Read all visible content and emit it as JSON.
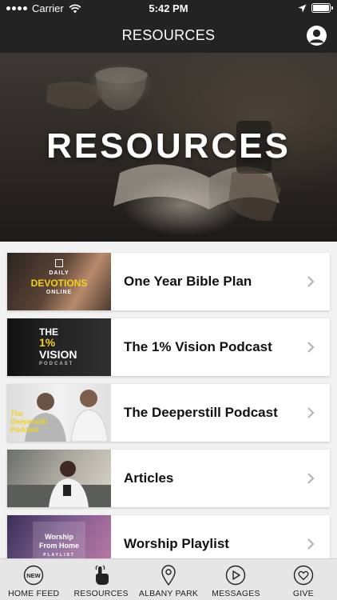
{
  "status_bar": {
    "carrier": "Carrier",
    "time": "5:42 PM"
  },
  "header": {
    "title": "RESOURCES"
  },
  "hero": {
    "title": "RESOURCES"
  },
  "items": [
    {
      "label": "One Year Bible Plan",
      "thumb_lines": [
        "DAILY",
        "DEVOTIONS",
        "ONLINE"
      ]
    },
    {
      "label": "The 1% Vision Podcast",
      "thumb_lines": [
        "THE",
        "1%",
        "VISION",
        "PODCAST"
      ]
    },
    {
      "label": "The Deeperstill Podcast",
      "thumb_lines": [
        "The",
        "Deeperstill",
        "Podcast"
      ]
    },
    {
      "label": "Articles"
    },
    {
      "label": "Worship Playlist",
      "thumb_lines": [
        "Worship",
        "From Home",
        "PLAYLIST"
      ]
    }
  ],
  "tabs": [
    {
      "label": "HOME FEED",
      "icon": "new-badge-icon",
      "badge": "NEW"
    },
    {
      "label": "RESOURCES",
      "icon": "touch-hand-icon"
    },
    {
      "label": "ALBANY PARK",
      "icon": "map-pin-icon"
    },
    {
      "label": "MESSAGES",
      "icon": "play-circle-icon"
    },
    {
      "label": "GIVE",
      "icon": "heart-circle-icon"
    }
  ],
  "colors": {
    "bar": "#232323",
    "tabbar": "#e6e6e6",
    "accent_yellow": "#f2d21b"
  }
}
